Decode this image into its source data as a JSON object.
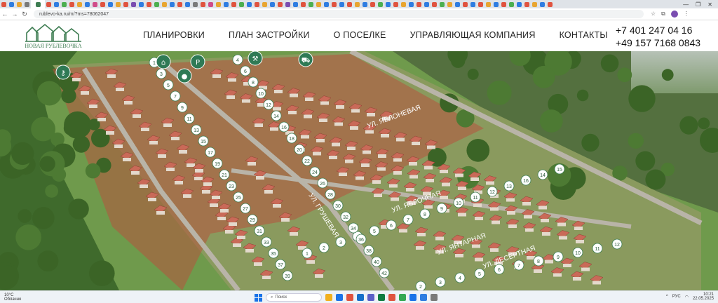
{
  "browser": {
    "url": "rublevo-ka.ru/m/?ms=78062047",
    "tab_colors": [
      "#e0533f",
      "#2f7de1",
      "#e8a531",
      "#7a7a7a",
      "#e0533f",
      "#2f7de1",
      "#4caf50",
      "#e0533f",
      "#e8a531",
      "#2f7de1",
      "#d04c8a",
      "#e0533f",
      "#2f7de1",
      "#e8a531",
      "#e0533f",
      "#7a4db0",
      "#2f7de1",
      "#e0533f",
      "#4caf50",
      "#e8a531",
      "#2f7de1",
      "#e0533f",
      "#2f7de1",
      "#7a7a7a",
      "#e0533f",
      "#d04c8a",
      "#e8a531",
      "#2f7de1",
      "#e0533f",
      "#4caf50",
      "#2f7de1",
      "#e0533f",
      "#e8a531",
      "#2f7de1",
      "#e0533f",
      "#7a4db0",
      "#2f7de1",
      "#e0533f",
      "#4caf50",
      "#e8a531",
      "#2f7de1",
      "#e0533f",
      "#2f7de1",
      "#e0533f",
      "#e8a531",
      "#2f7de1",
      "#e0533f",
      "#4caf50",
      "#2f7de1",
      "#e0533f",
      "#e8a531",
      "#2f7de1",
      "#e0533f",
      "#2f7de1",
      "#e0533f",
      "#4caf50",
      "#e8a531",
      "#2f7de1",
      "#e0533f",
      "#2f7de1",
      "#e0533f",
      "#e8a531",
      "#2f7de1",
      "#e0533f",
      "#4caf50",
      "#2f7de1",
      "#e0533f",
      "#e8a531",
      "#2f7de1",
      "#e0533f"
    ],
    "window_controls": [
      "—",
      "❐",
      "✕"
    ]
  },
  "site": {
    "logo_text": "НОВАЯ РУБЛЕВОЧКА",
    "nav": [
      "ПЛАНИРОВКИ",
      "ПЛАН ЗАСТРОЙКИ",
      "О ПОСЕЛКЕ",
      "УПРАВЛЯЮЩАЯ КОМПАНИЯ",
      "КОНТАКТЫ"
    ],
    "phone_1": "+7 401 247 04 16",
    "phone_2": "+49 157 7168 0843",
    "accent_green": "#2f7a55"
  },
  "map": {
    "street_labels": [
      "УЛ. ЯБЛОНЕВАЯ",
      "УЛ. ЯБЛОЧНАЯ",
      "УЛ. ЯНТАРНАЯ",
      "УЛ. ДЕСЕРТНАЯ",
      "УЛ. ГРУШЕВАЯ"
    ],
    "lot_numbers_a": [
      "15",
      "14",
      "16",
      "13",
      "12",
      "11",
      "10",
      "9",
      "8",
      "7",
      "6",
      "5",
      "4",
      "3",
      "2",
      "1"
    ],
    "lot_numbers_b": [
      "12",
      "11",
      "10",
      "9",
      "8",
      "7",
      "6",
      "5",
      "4",
      "3",
      "2",
      "1"
    ],
    "lot_numbers_c": [
      "42",
      "40",
      "38",
      "36",
      "34",
      "32",
      "30",
      "28",
      "26",
      "24",
      "22",
      "20",
      "18",
      "16",
      "14",
      "12",
      "10",
      "8",
      "6",
      "4",
      "2"
    ],
    "lot_numbers_d": [
      "39",
      "37",
      "35",
      "33",
      "31",
      "29",
      "27",
      "25",
      "23",
      "21",
      "19",
      "17",
      "15",
      "13",
      "11",
      "9",
      "7",
      "5",
      "3",
      "1"
    ],
    "amenity_icons": [
      "key-icon",
      "playground-icon",
      "sport-icon",
      "parking-icon",
      "tools-icon",
      "car-icon"
    ]
  },
  "taskbar": {
    "weather_temp": "10°C",
    "weather_desc": "Облачно",
    "search_placeholder": "Поиск",
    "lang": "РУС",
    "time": "10:21",
    "date": "22.05.2025",
    "app_colors": [
      "#f2b01e",
      "#1a73e8",
      "#e0533f",
      "#1570c9",
      "#5b5fc7",
      "#107c41",
      "#e0533f",
      "#34a853",
      "#1a73e8",
      "#2f7de1",
      "#7a7a7a"
    ]
  }
}
